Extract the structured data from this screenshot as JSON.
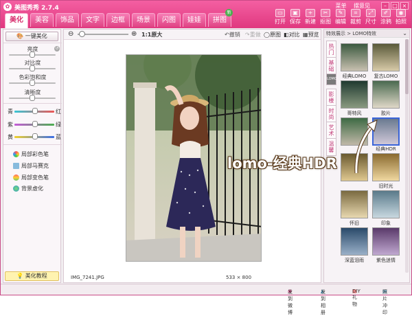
{
  "app": {
    "title": "美图秀秀 2.7.4",
    "links": [
      "菜单",
      "摆意见"
    ]
  },
  "tabs": [
    {
      "label": "美化",
      "active": true
    },
    {
      "label": "美容"
    },
    {
      "label": "饰品"
    },
    {
      "label": "文字"
    },
    {
      "label": "边框"
    },
    {
      "label": "场景"
    },
    {
      "label": "闪图"
    },
    {
      "label": "娃娃"
    },
    {
      "label": "拼图",
      "badge": "新"
    }
  ],
  "toolbar": [
    "打开",
    "保存",
    "新建",
    "抠图",
    "编辑",
    "裁剪",
    "尺寸",
    "涂鸦",
    "拍照"
  ],
  "left_panel": {
    "one_click": "一键美化",
    "adjust_labels": [
      "亮度",
      "对比度",
      "色彩饱和度",
      "清晰度"
    ],
    "color_sliders": [
      [
        "青",
        "红"
      ],
      [
        "紫",
        "绿"
      ],
      [
        "黄",
        "蓝"
      ]
    ],
    "tools": [
      "局部彩色笔",
      "局部马赛克",
      "局部变色笔",
      "背景虚化"
    ],
    "tutorial": "美化教程"
  },
  "canvas_bar": {
    "zoom": "1:1原大",
    "undo": "撤销",
    "redo": "重做",
    "original": "原图",
    "compare": "对比",
    "preview": "预览"
  },
  "status": {
    "filename": "IMG_7241.JPG",
    "dimensions": "533 × 800"
  },
  "right_panel": {
    "header": "特效展示 > LOMO特效",
    "side_tabs": [
      "热门",
      "基础",
      "LOMO",
      "影楼",
      "时尚",
      "艺术",
      "温馨"
    ],
    "effects": [
      "经典LOMO",
      "复古LOMO",
      "哥特风",
      "胶片",
      "经典HDR",
      "旧时光",
      "怀旧",
      "印象",
      "深蓝泪雨",
      "紫色迷情"
    ]
  },
  "annotation": "lomo-经典HDR",
  "bottom": [
    "发到微博",
    "发到相册",
    "DIY礼物",
    "照片冲印"
  ],
  "colors": {
    "brand": "#e0387f",
    "cyan_red": "#e55",
    "purple_green": "#4caf50",
    "yellow_blue": "#3a6ee8"
  }
}
